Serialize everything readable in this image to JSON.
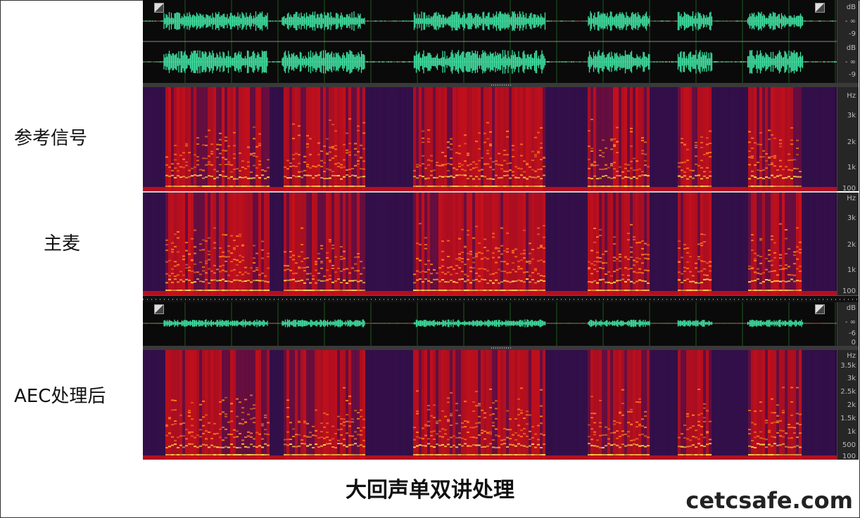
{
  "labels": {
    "reference": "参考信号",
    "main_mic": "主麦",
    "aec": "AEC处理后"
  },
  "caption": "大回声单双讲处理",
  "watermark": "cetcsafe.com",
  "waveform_scale": {
    "unit": "dB",
    "neg_inf": "- ∞",
    "minus9": "-9"
  },
  "waveform_scale_bottom": {
    "unit": "dB",
    "neg_inf": "- ∞",
    "minus6": "-6",
    "zero": "0"
  },
  "spec_scale_top": {
    "unit": "Hz",
    "t3k": "3k",
    "t2k": "2k",
    "t1k": "1k",
    "t100": "100"
  },
  "spec_scale_bottom": {
    "unit": "Hz",
    "t35k": "3.5k",
    "t3k": "3k",
    "t25k": "2.5k",
    "t2k": "2k",
    "t15k": "1.5k",
    "t1k": "1k",
    "t500": "500",
    "t100": "100"
  },
  "colors": {
    "waveform": "#3ee0a0",
    "spectrogram_low": "#2a0a40",
    "spectrogram_mid": "#c8101a",
    "spectrogram_high": "#ffd84a",
    "grid": "#1f5a1f"
  }
}
